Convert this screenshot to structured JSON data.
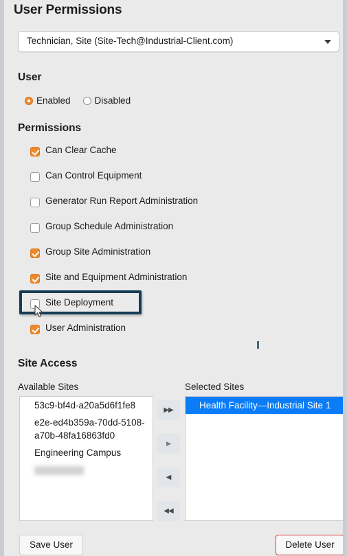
{
  "page": {
    "title": "User Permissions"
  },
  "role_select": {
    "value": "Technician, Site (Site-Tech@Industrial-Client.com)",
    "caret_icon": "chevron-down-icon"
  },
  "user_section": {
    "heading": "User",
    "options": [
      {
        "label": "Enabled",
        "selected": true
      },
      {
        "label": "Disabled",
        "selected": false
      }
    ]
  },
  "permissions_section": {
    "heading": "Permissions",
    "items": [
      {
        "label": "Can Clear Cache",
        "checked": true,
        "focused": false
      },
      {
        "label": "Can Control Equipment",
        "checked": false,
        "focused": false
      },
      {
        "label": "Generator Run Report Administration",
        "checked": false,
        "focused": false
      },
      {
        "label": "Group Schedule Administration",
        "checked": false,
        "focused": false
      },
      {
        "label": "Group Site Administration",
        "checked": true,
        "focused": false
      },
      {
        "label": "Site and Equipment Administration",
        "checked": true,
        "focused": false
      },
      {
        "label": "Site Deployment",
        "checked": false,
        "focused": true
      },
      {
        "label": "User Administration",
        "checked": true,
        "focused": false
      }
    ]
  },
  "site_access": {
    "heading": "Site Access",
    "available_label": "Available Sites",
    "selected_label": "Selected Sites",
    "available_sites": [
      "53c9-bf4d-a20a5d6f1fe8",
      "e2e-ed4b359a-70dd-5108-a70b-48fa16863fd0",
      "Engineering Campus",
      ""
    ],
    "selected_sites": [
      "Health Facility—Industrial Site 1"
    ],
    "transfer_buttons": [
      {
        "name": "move-all-right-button",
        "glyph": "▶▶"
      },
      {
        "name": "move-right-button",
        "glyph": "▶"
      },
      {
        "name": "move-left-button",
        "glyph": "◀"
      },
      {
        "name": "move-all-left-button",
        "glyph": "◀◀"
      }
    ]
  },
  "footer": {
    "save_label": "Save User",
    "delete_label": "Delete User"
  },
  "colors": {
    "accent_orange": "#ee8a2d",
    "selection_blue": "#0a7cf7",
    "focus_navy": "#173c55",
    "danger_red": "#d93636",
    "panel_bg": "#eaeaea"
  }
}
